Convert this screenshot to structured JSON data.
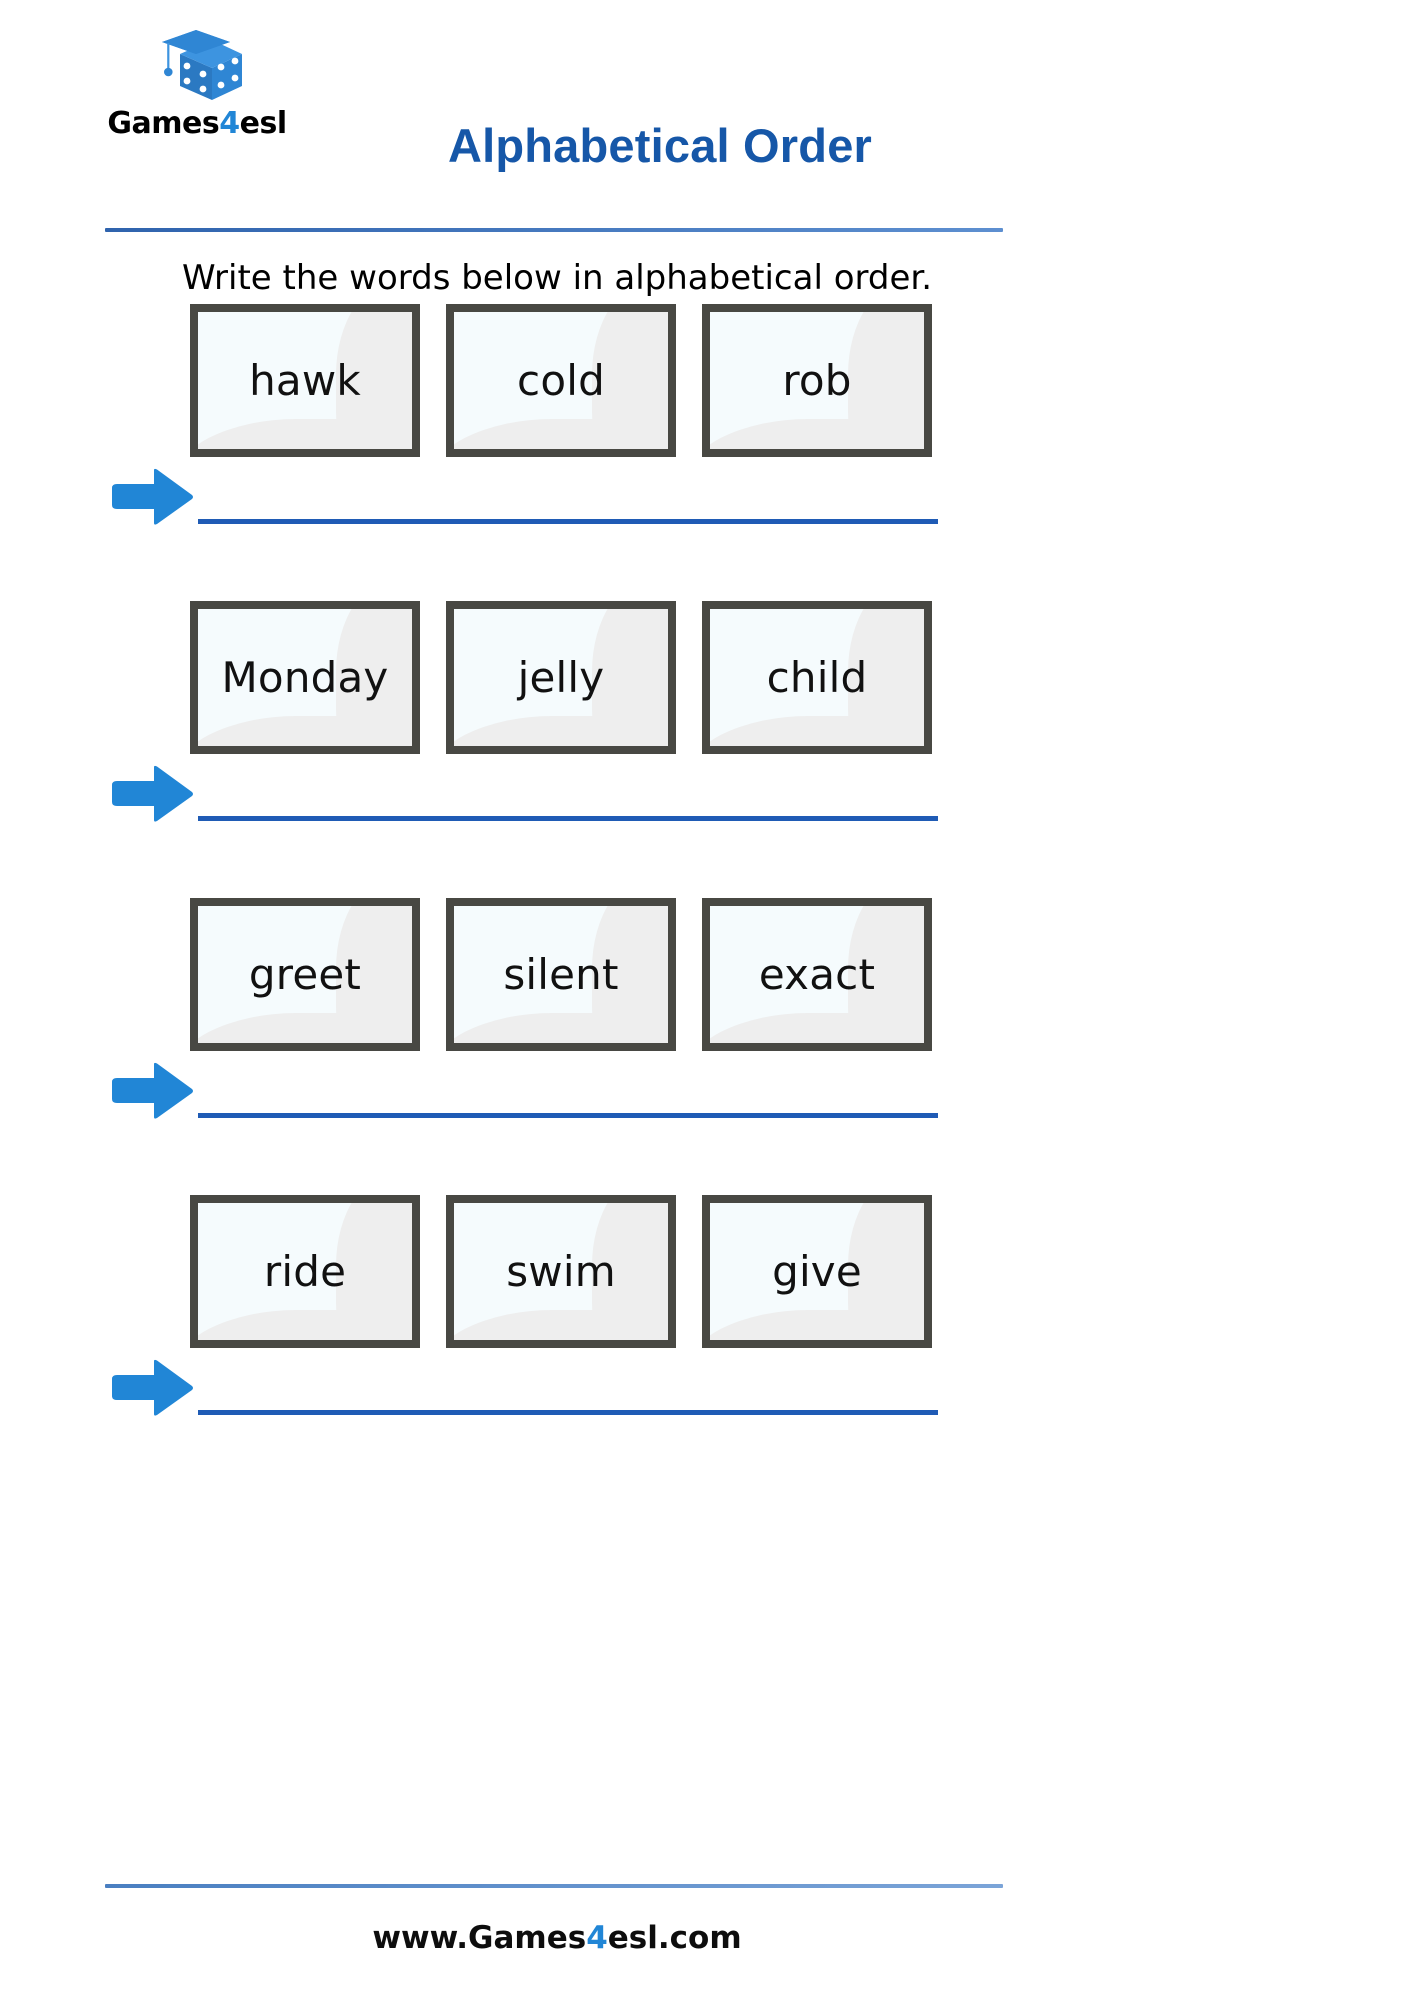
{
  "colors": {
    "title_blue": "#1657a8",
    "accent_blue": "#2186d6",
    "line_blue": "#1f5bb5",
    "box_border": "#484843",
    "box_fill": "#f5fbfd"
  },
  "header": {
    "logo": {
      "name": "Games4esl",
      "text_before": "Games",
      "text_accent": "4",
      "text_after": "esl",
      "icon": "graduation-cap-dice-logo"
    },
    "title": "Alphabetical Order"
  },
  "instruction": "Write the words below in alphabetical order.",
  "exercises": [
    {
      "id": 1,
      "words": [
        "hawk",
        "cold",
        "rob"
      ],
      "answer": "",
      "arrow_icon": "right-arrow-icon"
    },
    {
      "id": 2,
      "words": [
        "Monday",
        "jelly",
        "child"
      ],
      "answer": "",
      "arrow_icon": "right-arrow-icon"
    },
    {
      "id": 3,
      "words": [
        "greet",
        "silent",
        "exact"
      ],
      "answer": "",
      "arrow_icon": "right-arrow-icon"
    },
    {
      "id": 4,
      "words": [
        "ride",
        "swim",
        "give"
      ],
      "answer": "",
      "arrow_icon": "right-arrow-icon"
    }
  ],
  "footer": {
    "text_before": "www.Games",
    "text_accent": "4",
    "text_after": "esl.com"
  }
}
